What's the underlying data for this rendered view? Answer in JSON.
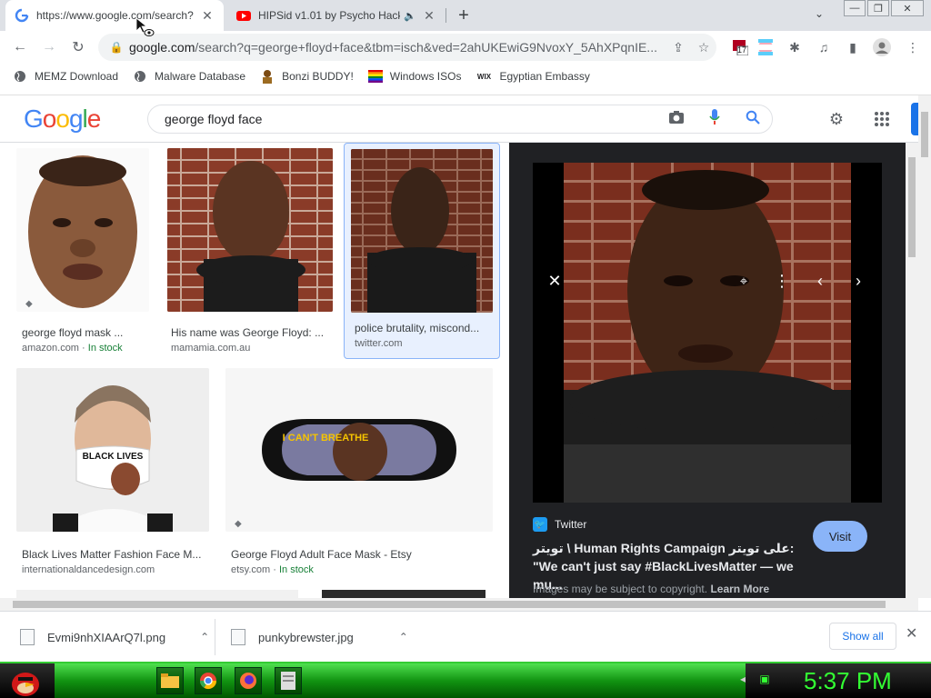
{
  "colors": {
    "tabstrip": "#dee1e6",
    "link_blue": "#1a73e8",
    "stock_green": "#188038",
    "preview_bg": "#202124",
    "visit_button": "#8ab4f8",
    "clock_green": "#33ff33"
  },
  "tabs": [
    {
      "title": "https://www.google.com/search?",
      "icon": "google-g-icon",
      "active": true
    },
    {
      "title": "HIPSid v1.01 by Psycho Hack",
      "icon": "youtube-icon",
      "audio": true,
      "active": false
    }
  ],
  "toolbar": {
    "url_host": "google.com",
    "url_rest": "/search?q=george+floyd+face&tbm=isch&ved=2ahUKEwiG9NvoxY_5AhXPqnIE...",
    "extension_badge": "17"
  },
  "bookmarks": [
    {
      "label": "MEMZ Download",
      "icon": "globe-icon"
    },
    {
      "label": "Malware Database",
      "icon": "globe-icon"
    },
    {
      "label": "Bonzi BUDDY!",
      "icon": "bonzi-icon"
    },
    {
      "label": "Windows ISOs",
      "icon": "rainbow-flag-icon"
    },
    {
      "label": "Egyptian Embassy",
      "icon": "wix-icon",
      "icon_text": "WIX"
    }
  ],
  "google": {
    "logo": "Google",
    "query": "george floyd face"
  },
  "results": [
    {
      "caption": "george floyd mask ...",
      "source": "amazon.com",
      "stock": "In stock"
    },
    {
      "caption": "His name was George Floyd: ...",
      "source": "mamamia.com.au",
      "stock": ""
    },
    {
      "caption": "police brutality, miscond...",
      "source": "twitter.com",
      "stock": ""
    },
    {
      "caption": "Black Lives Matter Fashion Face M...",
      "source": "internationaldancedesign.com",
      "stock": ""
    },
    {
      "caption": "George Floyd Adult Face Mask - Etsy",
      "source": "etsy.com",
      "stock": "In stock"
    }
  ],
  "mask_text": {
    "blm": "BLACK LIVES",
    "cant_breathe": "I CAN'T BREATHE"
  },
  "preview": {
    "source": "Twitter",
    "title": "تويتر \\ Human Rights Campaign على تويتر: \"We can't just say #BlackLivesMatter — we mu...",
    "visit": "Visit",
    "note_prefix": "Images may be subject to copyright.",
    "note_link": "Learn More"
  },
  "downloads": [
    {
      "filename": "Evmi9nhXIAArQ7l.png"
    },
    {
      "filename": "punkybrewster.jpg"
    }
  ],
  "downloads_show_all": "Show all",
  "taskbar": {
    "clock": "5:37 PM"
  }
}
